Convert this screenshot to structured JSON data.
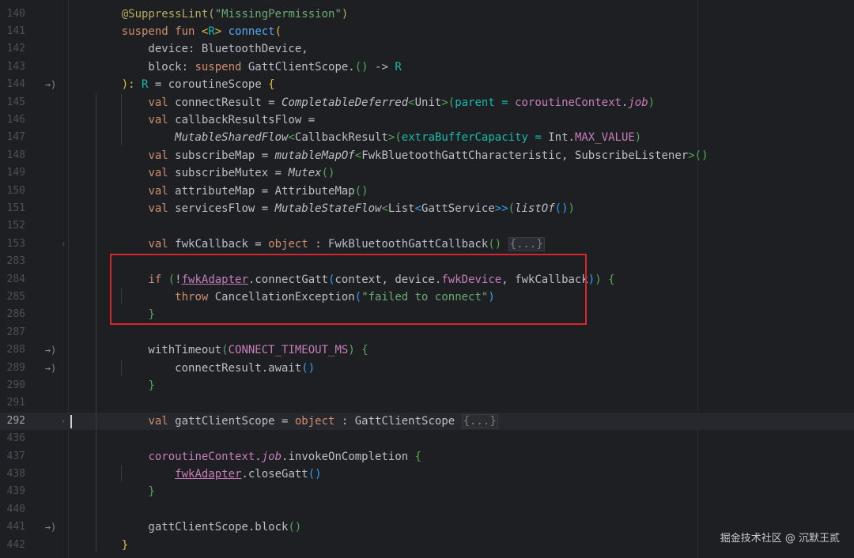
{
  "lines": [
    {
      "n": "140",
      "mark": "",
      "fold": "",
      "current": false,
      "tokens": [
        [
          "    ",
          ""
        ],
        [
          "@SuppressLint(",
          "ann"
        ],
        [
          "\"MissingPermission\"",
          "str"
        ],
        [
          ")",
          "ann"
        ]
      ]
    },
    {
      "n": "141",
      "mark": "",
      "fold": "",
      "current": false,
      "tokens": [
        [
          "    ",
          ""
        ],
        [
          "suspend ",
          "kw"
        ],
        [
          "fun ",
          "kw"
        ],
        [
          "<",
          "bk1"
        ],
        [
          "R",
          "tp"
        ],
        [
          "> ",
          "bk1"
        ],
        [
          "connect",
          "fn"
        ],
        [
          "(",
          "bk1"
        ]
      ]
    },
    {
      "n": "142",
      "mark": "",
      "fold": "",
      "current": false,
      "tokens": [
        [
          "        device: BluetoothDevice,",
          ""
        ]
      ]
    },
    {
      "n": "143",
      "mark": "",
      "fold": "",
      "current": false,
      "tokens": [
        [
          "        block: ",
          ""
        ],
        [
          "suspend ",
          "kw"
        ],
        [
          "GattClientScope.",
          ""
        ],
        [
          "()",
          "bk2"
        ],
        [
          " -> ",
          ""
        ],
        [
          "R",
          "tp"
        ]
      ]
    },
    {
      "n": "144",
      "mark": "→)",
      "fold": "",
      "current": false,
      "tokens": [
        [
          "    ",
          ""
        ],
        [
          "): ",
          "bk1"
        ],
        [
          "R",
          "tp"
        ],
        [
          " = coroutineScope ",
          ""
        ],
        [
          "{",
          "bk1"
        ]
      ]
    },
    {
      "n": "145",
      "mark": "",
      "fold": "",
      "current": false,
      "tokens": [
        [
          "        ",
          ""
        ],
        [
          "val ",
          "kw"
        ],
        [
          "connectResult = ",
          ""
        ],
        [
          "CompletableDeferred",
          "it"
        ],
        [
          "<",
          "bk2"
        ],
        [
          "Unit",
          ""
        ],
        [
          ">",
          "bk2"
        ],
        [
          "(",
          "bk2"
        ],
        [
          "parent = ",
          "tp"
        ],
        [
          "coroutineContext",
          "prop"
        ],
        [
          ".",
          ""
        ],
        [
          "job",
          "prop it"
        ],
        [
          ")",
          "bk2"
        ]
      ]
    },
    {
      "n": "146",
      "mark": "",
      "fold": "",
      "current": false,
      "tokens": [
        [
          "        ",
          ""
        ],
        [
          "val ",
          "kw"
        ],
        [
          "callbackResultsFlow =",
          ""
        ]
      ]
    },
    {
      "n": "147",
      "mark": "",
      "fold": "",
      "current": false,
      "tokens": [
        [
          "            ",
          ""
        ],
        [
          "MutableSharedFlow",
          "it"
        ],
        [
          "<",
          "bk2"
        ],
        [
          "CallbackResult",
          ""
        ],
        [
          ">",
          "bk2"
        ],
        [
          "(",
          "bk2"
        ],
        [
          "extraBufferCapacity = ",
          "tp"
        ],
        [
          "Int.",
          ""
        ],
        [
          "MAX_VALUE",
          "prop"
        ],
        [
          ")",
          "bk2"
        ]
      ]
    },
    {
      "n": "148",
      "mark": "",
      "fold": "",
      "current": false,
      "tokens": [
        [
          "        ",
          ""
        ],
        [
          "val ",
          "kw"
        ],
        [
          "subscribeMap = ",
          ""
        ],
        [
          "mutableMapOf",
          "it"
        ],
        [
          "<",
          "bk2"
        ],
        [
          "FwkBluetoothGattCharacteristic, SubscribeListener",
          ""
        ],
        [
          ">",
          "bk2"
        ],
        [
          "()",
          "bk2"
        ]
      ]
    },
    {
      "n": "149",
      "mark": "",
      "fold": "",
      "current": false,
      "tokens": [
        [
          "        ",
          ""
        ],
        [
          "val ",
          "kw"
        ],
        [
          "subscribeMutex = ",
          ""
        ],
        [
          "Mutex",
          "it"
        ],
        [
          "()",
          "bk2"
        ]
      ]
    },
    {
      "n": "150",
      "mark": "",
      "fold": "",
      "current": false,
      "tokens": [
        [
          "        ",
          ""
        ],
        [
          "val ",
          "kw"
        ],
        [
          "attributeMap = AttributeMap",
          ""
        ],
        [
          "()",
          "bk2"
        ]
      ]
    },
    {
      "n": "151",
      "mark": "",
      "fold": "",
      "current": false,
      "tokens": [
        [
          "        ",
          ""
        ],
        [
          "val ",
          "kw"
        ],
        [
          "servicesFlow = ",
          ""
        ],
        [
          "MutableStateFlow",
          "it"
        ],
        [
          "<",
          "bk2"
        ],
        [
          "List",
          ""
        ],
        [
          "<",
          "bk3"
        ],
        [
          "GattService",
          ""
        ],
        [
          ">>",
          "bk3"
        ],
        [
          "(",
          "bk2"
        ],
        [
          "listOf",
          "it"
        ],
        [
          "()",
          "bk3"
        ],
        [
          ")",
          "bk2"
        ]
      ]
    },
    {
      "n": "152",
      "mark": "",
      "fold": "",
      "current": false,
      "tokens": []
    },
    {
      "n": "153",
      "mark": "",
      "fold": "›",
      "current": false,
      "tokens": [
        [
          "        ",
          ""
        ],
        [
          "val ",
          "kw"
        ],
        [
          "fwkCallback = ",
          ""
        ],
        [
          "object ",
          "kw"
        ],
        [
          ": FwkBluetoothGattCallback",
          ""
        ],
        [
          "()",
          "bk2"
        ],
        [
          " ",
          ""
        ],
        [
          "{...}",
          "fold-pl"
        ]
      ]
    },
    {
      "n": "283",
      "mark": "",
      "fold": "",
      "current": false,
      "tokens": []
    },
    {
      "n": "284",
      "mark": "",
      "fold": "",
      "current": false,
      "tokens": [
        [
          "        ",
          ""
        ],
        [
          "if ",
          "kw"
        ],
        [
          "(",
          "bk2"
        ],
        [
          "!",
          ""
        ],
        [
          "fwkAdapter",
          "prop ul"
        ],
        [
          ".connectGatt",
          ""
        ],
        [
          "(",
          "bk3"
        ],
        [
          "context, device.",
          ""
        ],
        [
          "fwkDevice",
          "prop"
        ],
        [
          ", fwkCallback",
          ""
        ],
        [
          ")",
          "bk3"
        ],
        [
          ")",
          "bk2"
        ],
        [
          " ",
          ""
        ],
        [
          "{",
          "bk2"
        ]
      ]
    },
    {
      "n": "285",
      "mark": "",
      "fold": "",
      "current": false,
      "tokens": [
        [
          "            ",
          ""
        ],
        [
          "throw ",
          "kw"
        ],
        [
          "CancellationException",
          ""
        ],
        [
          "(",
          "bk3"
        ],
        [
          "\"failed to connect\"",
          "str"
        ],
        [
          ")",
          "bk3"
        ]
      ]
    },
    {
      "n": "286",
      "mark": "",
      "fold": "",
      "current": false,
      "tokens": [
        [
          "        ",
          ""
        ],
        [
          "}",
          "bk2"
        ]
      ]
    },
    {
      "n": "287",
      "mark": "",
      "fold": "",
      "current": false,
      "tokens": []
    },
    {
      "n": "288",
      "mark": "→)",
      "fold": "",
      "current": false,
      "tokens": [
        [
          "        withTimeout",
          ""
        ],
        [
          "(",
          "bk2"
        ],
        [
          "CONNECT_TIMEOUT_MS",
          "prop"
        ],
        [
          ")",
          "bk2"
        ],
        [
          " ",
          ""
        ],
        [
          "{",
          "bk2"
        ]
      ]
    },
    {
      "n": "289",
      "mark": "→)",
      "fold": "",
      "current": false,
      "tokens": [
        [
          "            connectResult.await",
          ""
        ],
        [
          "()",
          "bk3"
        ]
      ]
    },
    {
      "n": "290",
      "mark": "",
      "fold": "",
      "current": false,
      "tokens": [
        [
          "        ",
          ""
        ],
        [
          "}",
          "bk2"
        ]
      ]
    },
    {
      "n": "291",
      "mark": "",
      "fold": "",
      "current": false,
      "tokens": []
    },
    {
      "n": "292",
      "mark": "",
      "fold": "›",
      "current": true,
      "tokens": [
        [
          "        ",
          ""
        ],
        [
          "val ",
          "kw"
        ],
        [
          "gattClientScope = ",
          ""
        ],
        [
          "object ",
          "kw"
        ],
        [
          ": GattClientScope ",
          ""
        ],
        [
          "{...}",
          "fold-pl"
        ]
      ]
    },
    {
      "n": "436",
      "mark": "",
      "fold": "",
      "current": false,
      "tokens": []
    },
    {
      "n": "437",
      "mark": "",
      "fold": "",
      "current": false,
      "tokens": [
        [
          "        ",
          ""
        ],
        [
          "coroutineContext",
          "prop"
        ],
        [
          ".",
          ""
        ],
        [
          "job",
          "prop it"
        ],
        [
          ".invokeOnCompletion ",
          ""
        ],
        [
          "{",
          "bk2"
        ]
      ]
    },
    {
      "n": "438",
      "mark": "",
      "fold": "",
      "current": false,
      "tokens": [
        [
          "            ",
          ""
        ],
        [
          "fwkAdapter",
          "prop ul"
        ],
        [
          ".closeGatt",
          ""
        ],
        [
          "()",
          "bk3"
        ]
      ]
    },
    {
      "n": "439",
      "mark": "",
      "fold": "",
      "current": false,
      "tokens": [
        [
          "        ",
          ""
        ],
        [
          "}",
          "bk2"
        ]
      ]
    },
    {
      "n": "440",
      "mark": "",
      "fold": "",
      "current": false,
      "tokens": []
    },
    {
      "n": "441",
      "mark": "→)",
      "fold": "",
      "current": false,
      "tokens": [
        [
          "        gattClientScope.block",
          ""
        ],
        [
          "()",
          "bk2"
        ]
      ]
    },
    {
      "n": "442",
      "mark": "",
      "fold": "",
      "current": false,
      "tokens": [
        [
          "    ",
          ""
        ],
        [
          "}",
          "bk1"
        ]
      ]
    }
  ],
  "watermark": "掘金技术社区 @ 沉默王贰"
}
